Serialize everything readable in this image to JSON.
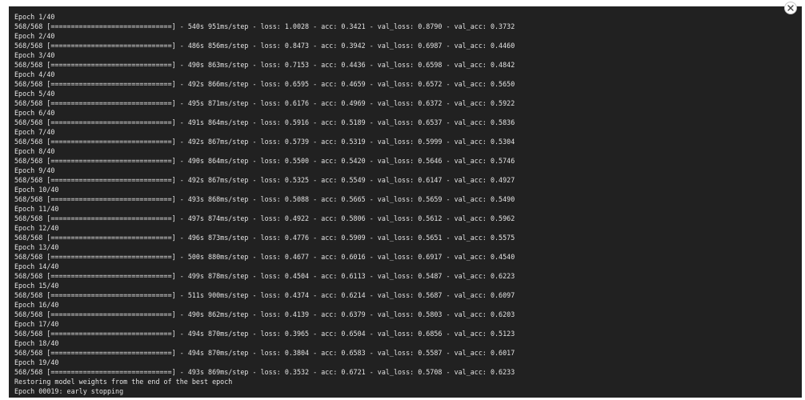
{
  "output": {
    "lines": [
      "Epoch 1/40",
      "568/568 [==============================] - 540s 951ms/step - loss: 1.0028 - acc: 0.3421 - val_loss: 0.8790 - val_acc: 0.3732",
      "Epoch 2/40",
      "568/568 [==============================] - 486s 856ms/step - loss: 0.8473 - acc: 0.3942 - val_loss: 0.6987 - val_acc: 0.4460",
      "Epoch 3/40",
      "568/568 [==============================] - 490s 863ms/step - loss: 0.7153 - acc: 0.4436 - val_loss: 0.6598 - val_acc: 0.4842",
      "Epoch 4/40",
      "568/568 [==============================] - 492s 866ms/step - loss: 0.6595 - acc: 0.4659 - val_loss: 0.6572 - val_acc: 0.5650",
      "Epoch 5/40",
      "568/568 [==============================] - 495s 871ms/step - loss: 0.6176 - acc: 0.4969 - val_loss: 0.6372 - val_acc: 0.5922",
      "Epoch 6/40",
      "568/568 [==============================] - 491s 864ms/step - loss: 0.5916 - acc: 0.5189 - val_loss: 0.6537 - val_acc: 0.5836",
      "Epoch 7/40",
      "568/568 [==============================] - 492s 867ms/step - loss: 0.5739 - acc: 0.5319 - val_loss: 0.5999 - val_acc: 0.5304",
      "Epoch 8/40",
      "568/568 [==============================] - 490s 864ms/step - loss: 0.5500 - acc: 0.5420 - val_loss: 0.5646 - val_acc: 0.5746",
      "Epoch 9/40",
      "568/568 [==============================] - 492s 867ms/step - loss: 0.5325 - acc: 0.5549 - val_loss: 0.6147 - val_acc: 0.4927",
      "Epoch 10/40",
      "568/568 [==============================] - 493s 868ms/step - loss: 0.5088 - acc: 0.5665 - val_loss: 0.5659 - val_acc: 0.5490",
      "Epoch 11/40",
      "568/568 [==============================] - 497s 874ms/step - loss: 0.4922 - acc: 0.5806 - val_loss: 0.5612 - val_acc: 0.5962",
      "Epoch 12/40",
      "568/568 [==============================] - 496s 873ms/step - loss: 0.4776 - acc: 0.5909 - val_loss: 0.5651 - val_acc: 0.5575",
      "Epoch 13/40",
      "568/568 [==============================] - 500s 880ms/step - loss: 0.4677 - acc: 0.6016 - val_loss: 0.6917 - val_acc: 0.4540",
      "Epoch 14/40",
      "568/568 [==============================] - 499s 878ms/step - loss: 0.4504 - acc: 0.6113 - val_loss: 0.5487 - val_acc: 0.6223",
      "Epoch 15/40",
      "568/568 [==============================] - 511s 900ms/step - loss: 0.4374 - acc: 0.6214 - val_loss: 0.5687 - val_acc: 0.6097",
      "Epoch 16/40",
      "568/568 [==============================] - 490s 862ms/step - loss: 0.4139 - acc: 0.6379 - val_loss: 0.5803 - val_acc: 0.6203",
      "Epoch 17/40",
      "568/568 [==============================] - 494s 870ms/step - loss: 0.3965 - acc: 0.6504 - val_loss: 0.6856 - val_acc: 0.5123",
      "Epoch 18/40",
      "568/568 [==============================] - 494s 870ms/step - loss: 0.3804 - acc: 0.6583 - val_loss: 0.5587 - val_acc: 0.6017",
      "Epoch 19/40",
      "568/568 [==============================] - 493s 869ms/step - loss: 0.3532 - acc: 0.6721 - val_loss: 0.5708 - val_acc: 0.6233",
      "Restoring model weights from the end of the best epoch",
      "Epoch 00019: early stopping"
    ]
  },
  "clear_button": {
    "icon": "close-icon"
  },
  "colors": {
    "panel_background": "#212121",
    "text": "#e3e3e3"
  }
}
